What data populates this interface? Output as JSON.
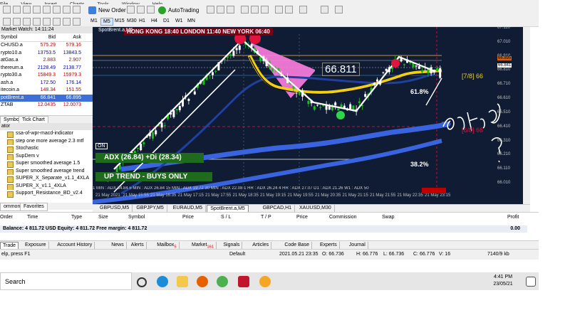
{
  "menu": [
    "File",
    "View",
    "Insert",
    "Charts",
    "Tools",
    "Window",
    "Help"
  ],
  "toolbar": {
    "new_order": "New Order",
    "autotrading": "AutoTrading"
  },
  "timeframes": [
    "M1",
    "M5",
    "M15",
    "M30",
    "H1",
    "H4",
    "D1",
    "W1",
    "MN"
  ],
  "timeframe_active": "M5",
  "market_watch": {
    "title": "Market Watch: 14:11:24",
    "col_symbol": "Symbol",
    "col_bid": "Bid",
    "col_ask": "Ask",
    "rows": [
      {
        "symbol": "CHUSD.a",
        "bid": "575.29",
        "ask": "579.16"
      },
      {
        "symbol": "rypto10.a",
        "bid": "13753.5",
        "ask": "13843.5"
      },
      {
        "symbol": "atGas.a",
        "bid": "2.883",
        "ask": "2.907"
      },
      {
        "symbol": "thereum.a",
        "bid": "2128.49",
        "ask": "2138.77"
      },
      {
        "symbol": "rypto30.a",
        "bid": "15849.3",
        "ask": "15979.3"
      },
      {
        "symbol": "ash.a",
        "bid": "172.50",
        "ask": "176.14"
      },
      {
        "symbol": "itecoin.a",
        "bid": "148.34",
        "ask": "151.55"
      },
      {
        "symbol": "potBrent.a",
        "bid": "66.841",
        "ask": "66.895"
      },
      {
        "symbol": "ZTAB",
        "bid": "12.0435",
        "ask": "12.0073"
      }
    ],
    "tabs": [
      "Symbols",
      "Tick Chart"
    ]
  },
  "navigator": {
    "title": "ator",
    "items": [
      "ssa-of-wpr-macd-indicator",
      "step one more average 2.3 mtf",
      "Stochastic",
      "SupDem v",
      "Super smoothed average 1.5",
      "Super smoothed average trend",
      "SUPER_X_Separate_v1.1_4XLA",
      "SUPER_X_v1.1_4XLA",
      "Support_Resistance_BD_v2.4"
    ],
    "tabs": [
      "ommon",
      "Favorites"
    ]
  },
  "chart": {
    "title": "SpotBrent.a,M5",
    "sessions": "HONG KONG 18:40   LONDON  11:40   NEW YORK  06:40",
    "price_box": "66.811",
    "fib_label": "[7/8]  66",
    "fib_label2": "[6/8]  66",
    "fib_pct1": "61.8%",
    "fib_pct2": "38.2%",
    "on_badge": "ON",
    "adx_text": "ADX (26.84)  +Di (28.34)",
    "trend_text": "UP TREND - BUYS ONLY",
    "handwriting": "entry ?",
    "price_axis": [
      "67.110",
      "67.010",
      "66.910",
      "66.895",
      "66.841",
      "66.810",
      "66.710",
      "66.610",
      "66.510",
      "66.410",
      "66.310",
      "66.210",
      "66.110",
      "66.010"
    ],
    "time_axis": [
      "21 May 2021",
      "21 May 15:55",
      "21 May 16:35",
      "21 May 17:15",
      "21 May 17:55",
      "21 May 18:35",
      "21 May 19:15",
      "21 May 19:55",
      "21 May 20:35",
      "21 May 21:15",
      "21 May 21:55",
      "21 May 22:35",
      "21 May 23:15"
    ],
    "tf_strip": "1 MIN : ADX 34.84   5 MIN : ADX 26.84   15 MIN : ADX 19.72   30 MIN : ADX 22.08   1 HR : ADX 26.24   4 HR : ADX 27.07   D1 : ADX 21.26   W1 : ADX 50",
    "tabs": [
      "GBPUSD,M5",
      "GBPJPY,M5",
      "EURAUD,M5",
      "SpotBrent.a,M5",
      "GBPCAD,H1",
      "XAUUSD,M30"
    ],
    "active_tab": "SpotBrent.a,M5",
    "colors": {
      "bg": "#0f1c33",
      "bull": "#18c018",
      "bear": "#ffffff",
      "white_line": "#ffffff",
      "blue": "#3a63e0",
      "yellow": "#f0d010",
      "pink": "#ff7ee0",
      "red": "#e0143c",
      "green_dot": "#2cd84a"
    }
  },
  "terminal": {
    "columns": [
      "Order",
      "Time",
      "Type",
      "Size",
      "Symbol",
      "Price",
      "S / L",
      "T / P",
      "Price",
      "Commission",
      "Swap",
      "Profit"
    ],
    "balance": "Balance: 4 811.72 USD  Equity: 4 811.72  Free margin: 4 811.72",
    "balance_value": "0.00",
    "tabs": [
      "Trade",
      "Exposure",
      "Account History",
      "News",
      "Alerts",
      "Mailbox",
      "Market",
      "Signals",
      "Articles",
      "Code Base",
      "Experts",
      "Journal"
    ],
    "mailbox_count": "5",
    "market_count": "161"
  },
  "status": {
    "help": "elp, press F1",
    "profile": "Default",
    "datetime": "2021.05.21 23:35",
    "open": "O: 66.736",
    "high": "H: 66.776",
    "low": "L: 66.736",
    "close": "C: 66.776",
    "volume": "V: 16",
    "traffic": "7140/9 kb"
  },
  "taskbar": {
    "search": "Search",
    "time": "4:41 PM",
    "date": "23/05/21"
  }
}
